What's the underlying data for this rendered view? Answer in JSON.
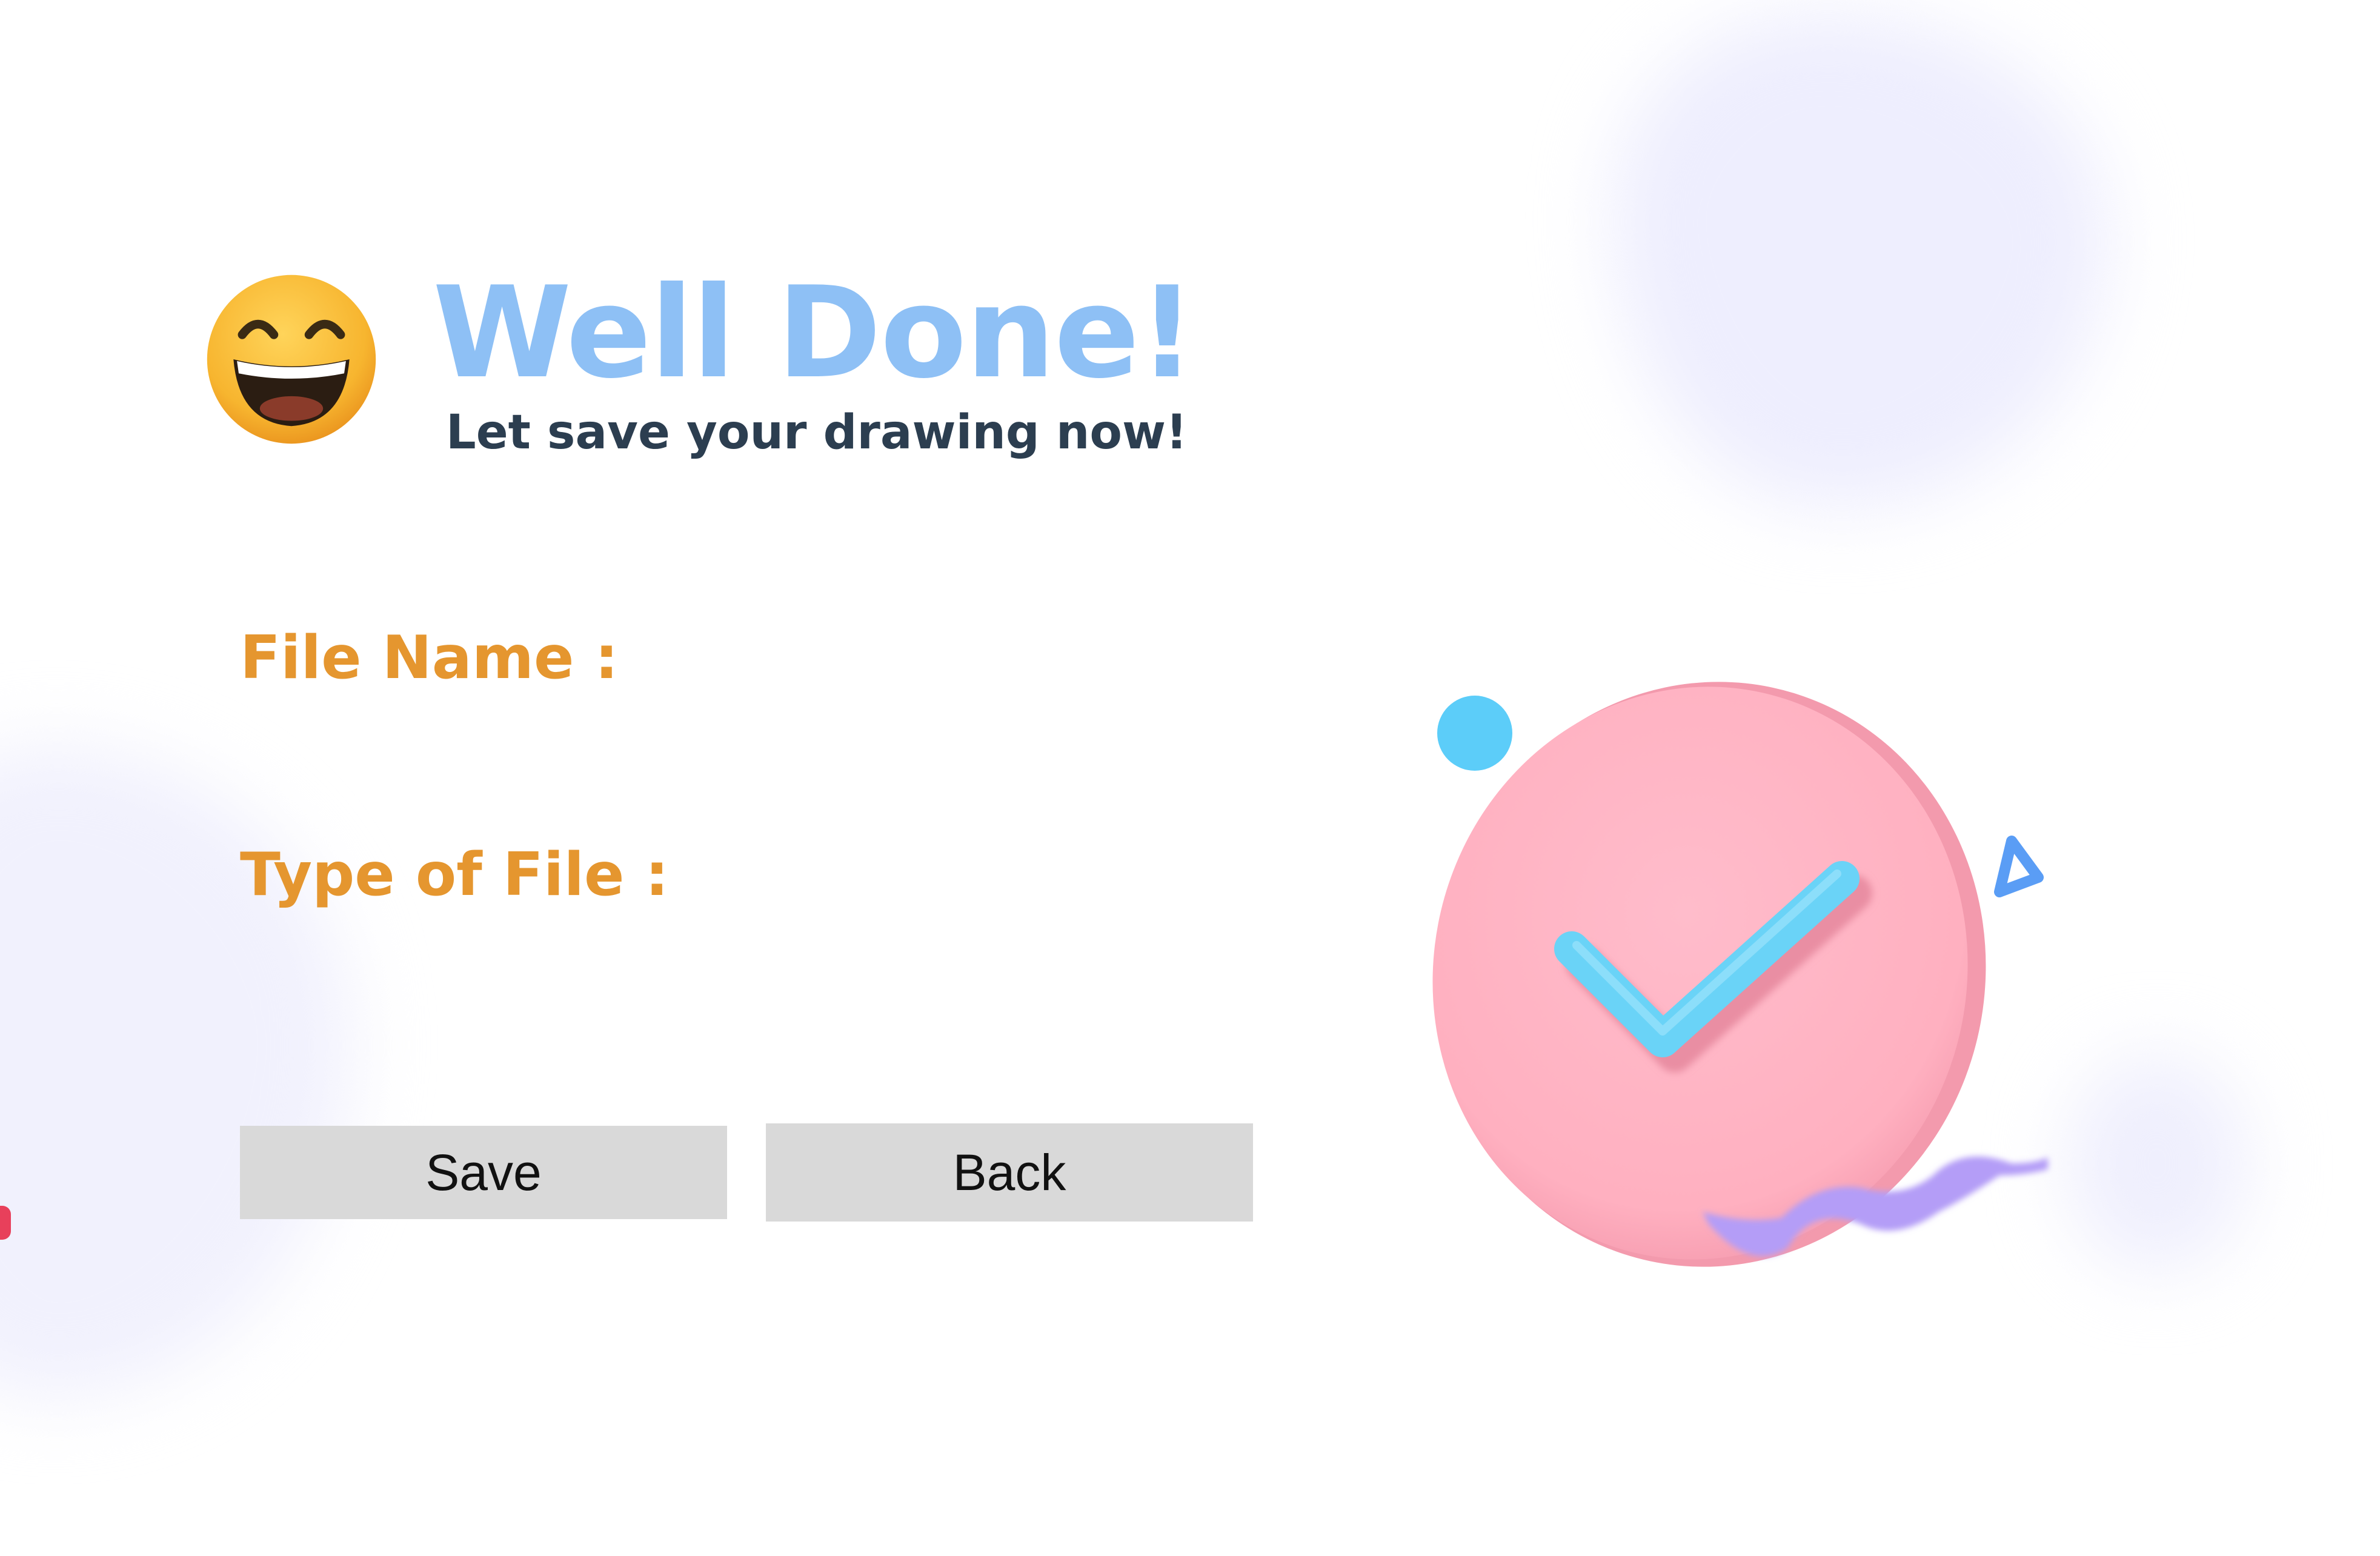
{
  "header": {
    "emoji_icon": "grinning-face-icon",
    "title": "Well Done!",
    "subtitle": "Let save your drawing now!"
  },
  "form": {
    "file_name_label": "File Name :",
    "file_type_label": "Type of File :"
  },
  "actions": {
    "save_label": "Save",
    "back_label": "Back"
  },
  "illustration": {
    "icon": "check-circle-icon",
    "colors": {
      "circle": "#ffb7c5",
      "check": "#6ad3f7",
      "ball": "#5ccdf9",
      "triangle": "#5a9df5",
      "ribbon": "#b49df7"
    }
  },
  "theme": {
    "title_color": "#8ec0f5",
    "subtitle_color": "#2c3e50",
    "label_color": "#e5962f",
    "button_bg": "#d9d9d9"
  }
}
